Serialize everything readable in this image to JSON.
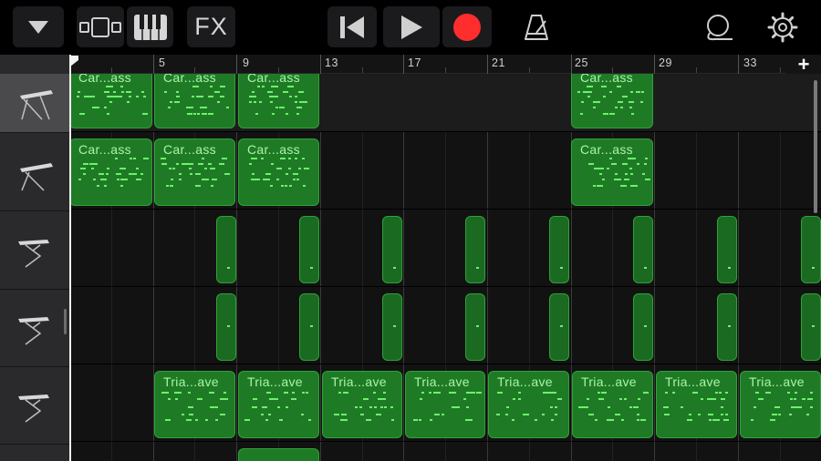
{
  "toolbar": {
    "items": [
      {
        "name": "track-view-dropdown",
        "icon": "chevron-down-icon"
      },
      {
        "name": "browser-toggle",
        "icon": "tracks-view-icon"
      },
      {
        "name": "instrument-view",
        "icon": "piano-keys-icon"
      },
      {
        "name": "fx-button",
        "label": "FX"
      },
      {
        "name": "go-to-start",
        "icon": "skip-back-icon"
      },
      {
        "name": "play",
        "icon": "play-icon"
      },
      {
        "name": "record",
        "icon": "record-icon",
        "color": "#ff2d2d"
      },
      {
        "name": "metronome",
        "icon": "metronome-icon"
      },
      {
        "name": "loops",
        "icon": "loop-browser-icon"
      },
      {
        "name": "settings",
        "icon": "settings-gear-icon"
      }
    ],
    "fx_label": "FX"
  },
  "ruler": {
    "bar_labels": [
      "5",
      "9",
      "13",
      "17",
      "21",
      "25",
      "29",
      "33"
    ],
    "add_label": "+"
  },
  "tracks": [
    {
      "instrument": "keyboard-synth-icon",
      "selected": true
    },
    {
      "instrument": "keyboard-synth-icon",
      "selected": false
    },
    {
      "instrument": "keyboard-stand-icon",
      "selected": false
    },
    {
      "instrument": "keyboard-stand-icon",
      "selected": false
    },
    {
      "instrument": "keyboard-stand-icon",
      "selected": false
    }
  ],
  "regions": {
    "track1": [
      {
        "label": "Car...ass"
      },
      {
        "label": "Car...ass"
      },
      {
        "label": "Car...ass"
      },
      {
        "label": "Car...ass"
      }
    ],
    "track2": [
      {
        "label": "Car...ass"
      },
      {
        "label": "Car...ass"
      },
      {
        "label": "Car...ass"
      },
      {
        "label": "Car...ass"
      }
    ],
    "track5": [
      {
        "label": "Tria...ave"
      },
      {
        "label": "Tria...ave"
      },
      {
        "label": "Tria...ave"
      },
      {
        "label": "Tria...ave"
      },
      {
        "label": "Tria...ave"
      },
      {
        "label": "Tria...ave"
      },
      {
        "label": "Tria...ave"
      },
      {
        "label": "Tria...ave"
      }
    ]
  },
  "colors": {
    "region_fill": "#1f7a26",
    "region_border": "#2fa238",
    "region_text": "#a9f5a4",
    "note": "#6bf36a",
    "record": "#ff2d2d"
  }
}
